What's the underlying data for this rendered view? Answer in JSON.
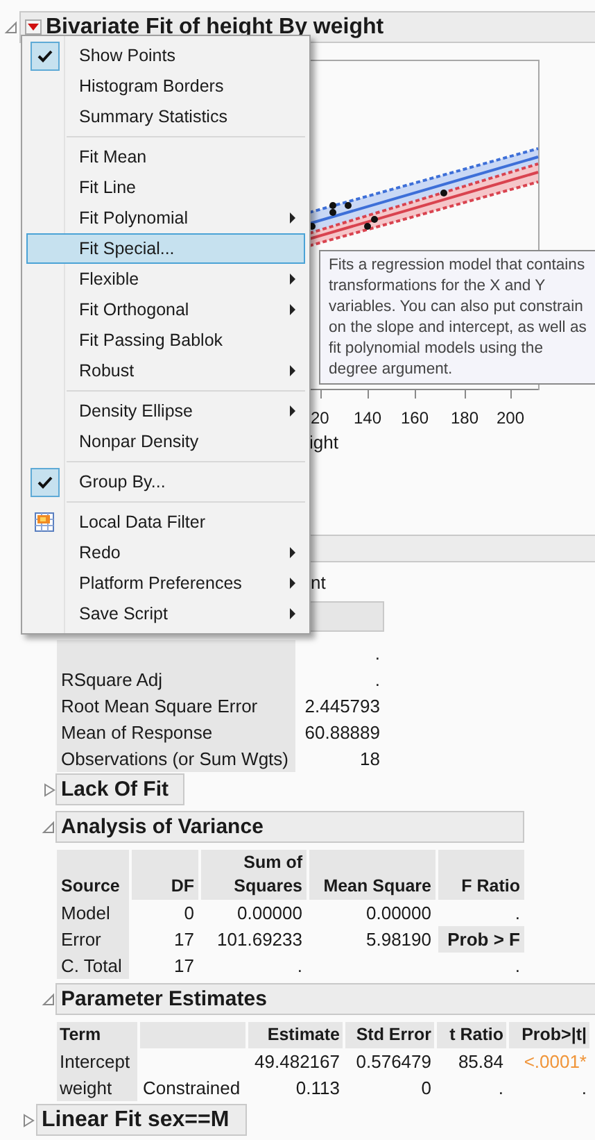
{
  "report": {
    "title": "Bivariate Fit of height By weight",
    "expanded": true
  },
  "plot": {
    "x_tick_labels": [
      "20",
      "140",
      "160",
      "180",
      "200"
    ],
    "x_axis_label": "ight"
  },
  "partial_text": "nt",
  "summary_of_fit": {
    "rows": [
      {
        "value": "."
      },
      {
        "label": "RSquare Adj",
        "value": "."
      },
      {
        "label": "Root Mean Square Error",
        "value": "2.445793"
      },
      {
        "label": "Mean of Response",
        "value": "60.88889"
      },
      {
        "label": "Observations (or Sum Wgts)",
        "value": "18"
      }
    ]
  },
  "lack_of_fit": {
    "title": "Lack Of Fit",
    "expanded": false
  },
  "analysis_of_variance": {
    "title": "Analysis of Variance",
    "expanded": true,
    "columns": [
      "Source",
      "DF",
      "Sum of Squares",
      "Mean Square",
      "F Ratio"
    ],
    "rows": [
      {
        "source": "Model",
        "df": "0",
        "sum_of_squares": "0.00000",
        "mean_square": "0.00000",
        "f_ratio": "."
      },
      {
        "source": "Error",
        "df": "17",
        "sum_of_squares": "101.69233",
        "mean_square": "5.98190",
        "prob_f_label": "Prob > F"
      },
      {
        "source": "C. Total",
        "df": "17",
        "sum_of_squares": ".",
        "f_ratio": "."
      }
    ]
  },
  "parameter_estimates": {
    "title": "Parameter Estimates",
    "expanded": true,
    "columns": [
      "Term",
      "",
      "Estimate",
      "Std Error",
      "t Ratio",
      "Prob>|t|"
    ],
    "rows": [
      {
        "term": "Intercept",
        "estimate": "49.482167",
        "std_error": "0.576479",
        "t_ratio": "85.84",
        "prob": "<.0001*",
        "significant": true
      },
      {
        "term": "weight",
        "note": "Constrained",
        "estimate": "0.113",
        "std_error": "0",
        "t_ratio": ".",
        "prob": ".",
        "significant": false
      }
    ]
  },
  "linear_fit_m": {
    "title": "Linear Fit sex==M",
    "expanded": false
  },
  "menu": {
    "items": [
      {
        "kind": "item",
        "label": "Show Points",
        "checked": true,
        "submenu": false,
        "selected": false
      },
      {
        "kind": "item",
        "label": "Histogram Borders",
        "checked": false,
        "submenu": false,
        "selected": false
      },
      {
        "kind": "item",
        "label": "Summary Statistics",
        "checked": false,
        "submenu": false,
        "selected": false
      },
      {
        "kind": "separator"
      },
      {
        "kind": "item",
        "label": "Fit Mean",
        "checked": false,
        "submenu": false,
        "selected": false
      },
      {
        "kind": "item",
        "label": "Fit Line",
        "checked": false,
        "submenu": false,
        "selected": false
      },
      {
        "kind": "item",
        "label": "Fit Polynomial",
        "checked": false,
        "submenu": true,
        "selected": false
      },
      {
        "kind": "item",
        "label": "Fit Special...",
        "checked": false,
        "submenu": false,
        "selected": true
      },
      {
        "kind": "item",
        "label": "Flexible",
        "checked": false,
        "submenu": true,
        "selected": false
      },
      {
        "kind": "item",
        "label": "Fit Orthogonal",
        "checked": false,
        "submenu": true,
        "selected": false
      },
      {
        "kind": "item",
        "label": "Fit Passing Bablok",
        "checked": false,
        "submenu": false,
        "selected": false
      },
      {
        "kind": "item",
        "label": "Robust",
        "checked": false,
        "submenu": true,
        "selected": false
      },
      {
        "kind": "separator"
      },
      {
        "kind": "item",
        "label": "Density Ellipse",
        "checked": false,
        "submenu": true,
        "selected": false
      },
      {
        "kind": "item",
        "label": "Nonpar Density",
        "checked": false,
        "submenu": false,
        "selected": false
      },
      {
        "kind": "separator"
      },
      {
        "kind": "item",
        "label": "Group By...",
        "checked": true,
        "submenu": false,
        "selected": false
      },
      {
        "kind": "separator"
      },
      {
        "kind": "icon_item",
        "label": "Local Data Filter",
        "checked": false,
        "submenu": false,
        "selected": false
      },
      {
        "kind": "item",
        "label": "Redo",
        "checked": false,
        "submenu": true,
        "selected": false
      },
      {
        "kind": "item",
        "label": "Platform Preferences",
        "checked": false,
        "submenu": true,
        "selected": false
      },
      {
        "kind": "item",
        "label": "Save Script",
        "checked": false,
        "submenu": true,
        "selected": false
      }
    ]
  },
  "tooltip": {
    "lines": [
      "Fits a regression model that contains",
      "transformations for the X and Y",
      "variables. You can also put constrain",
      "on the slope and intercept, as well as",
      "fit polynomial models using the",
      "degree argument."
    ]
  }
}
